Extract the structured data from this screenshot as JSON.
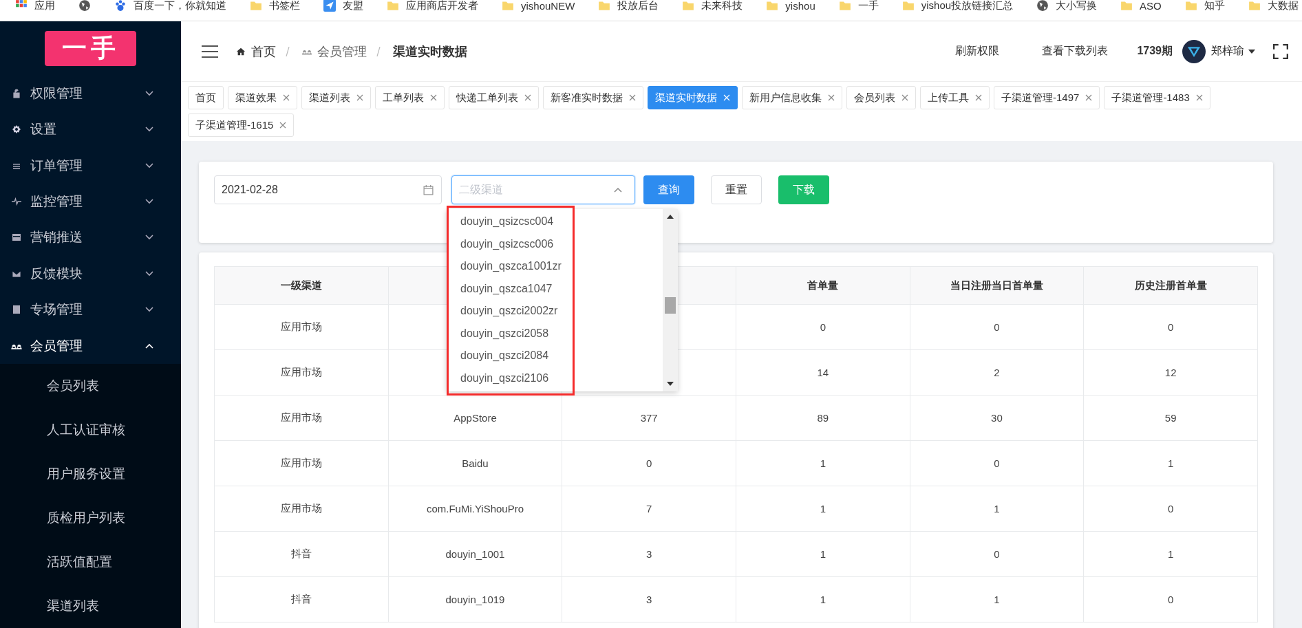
{
  "bookmarks": [
    {
      "label": "应用",
      "kind": "apps"
    },
    {
      "kind": "globe"
    },
    {
      "label": "百度一下，你就知道",
      "kind": "baidu"
    },
    {
      "label": "书签栏",
      "kind": "folder"
    },
    {
      "label": "友盟",
      "kind": "app"
    },
    {
      "label": "应用商店开发者",
      "kind": "folder"
    },
    {
      "label": "yishouNEW",
      "kind": "folder"
    },
    {
      "label": "投放后台",
      "kind": "folder"
    },
    {
      "label": "未来科技",
      "kind": "folder"
    },
    {
      "label": "yishou",
      "kind": "folder"
    },
    {
      "label": "一手",
      "kind": "folder"
    },
    {
      "label": "yishou投放链接汇总",
      "kind": "folder"
    },
    {
      "label": "大小写换",
      "kind": "globe"
    },
    {
      "label": "ASO",
      "kind": "folder"
    },
    {
      "label": "知乎",
      "kind": "folder"
    },
    {
      "label": "大数据",
      "kind": "folder"
    }
  ],
  "sidebar": {
    "logo": "一手",
    "items": [
      {
        "label": "权限管理",
        "kind": "lock",
        "expanded": false
      },
      {
        "label": "设置",
        "kind": "gear",
        "expanded": false
      },
      {
        "label": "订单管理",
        "kind": "list",
        "expanded": false
      },
      {
        "label": "监控管理",
        "kind": "pulse",
        "expanded": false
      },
      {
        "label": "营销推送",
        "kind": "card",
        "expanded": false
      },
      {
        "label": "反馈模块",
        "kind": "mail",
        "expanded": false
      },
      {
        "label": "专场管理",
        "kind": "doc",
        "expanded": false
      },
      {
        "label": "会员管理",
        "kind": "people",
        "expanded": true,
        "children": [
          {
            "label": "会员列表"
          },
          {
            "label": "人工认证审核"
          },
          {
            "label": "用户服务设置"
          },
          {
            "label": "质检用户列表"
          },
          {
            "label": "活跃值配置"
          },
          {
            "label": "渠道列表"
          }
        ]
      }
    ]
  },
  "header": {
    "breadcrumb": [
      "首页",
      "会员管理",
      "渠道实时数据"
    ],
    "actions": [
      "刷新权限",
      "查看下载列表"
    ],
    "period": "1739期",
    "user": "郑梓瑜"
  },
  "tabs": [
    {
      "label": "首页",
      "selected": false,
      "closable": false
    },
    {
      "label": "渠道效果",
      "selected": false,
      "closable": true
    },
    {
      "label": "渠道列表",
      "selected": false,
      "closable": true
    },
    {
      "label": "工单列表",
      "selected": false,
      "closable": true
    },
    {
      "label": "快递工单列表",
      "selected": false,
      "closable": true
    },
    {
      "label": "新客准实时数据",
      "selected": false,
      "closable": true
    },
    {
      "label": "渠道实时数据",
      "selected": true,
      "closable": true
    },
    {
      "label": "新用户信息收集",
      "selected": false,
      "closable": true
    },
    {
      "label": "会员列表",
      "selected": false,
      "closable": true
    },
    {
      "label": "上传工具",
      "selected": false,
      "closable": true
    },
    {
      "label": "子渠道管理-1497",
      "selected": false,
      "closable": true
    },
    {
      "label": "子渠道管理-1483",
      "selected": false,
      "closable": true
    },
    {
      "label": "子渠道管理-1615",
      "selected": false,
      "closable": true
    }
  ],
  "filter": {
    "date": "2021-02-28",
    "channel": {
      "placeholder": "二级渠道",
      "expanded": true,
      "options": [
        "douyin_qsizcsc004",
        "douyin_qsizcsc006",
        "douyin_qszca1001zr",
        "douyin_qszca1047",
        "douyin_qszci2002zr",
        "douyin_qszci2058",
        "douyin_qszci2084",
        "douyin_qszci2106"
      ]
    },
    "buttons": [
      {
        "label": "查询",
        "kind": "primary"
      },
      {
        "label": "重置",
        "kind": "plain"
      },
      {
        "label": "下载",
        "kind": "success"
      }
    ]
  },
  "table": {
    "columns": [
      "一级渠道",
      null,
      null,
      "首单量",
      "当日注册当日首单量",
      "历史注册首单量"
    ],
    "rows": [
      [
        "应用市场",
        null,
        null,
        "0",
        "0",
        "0"
      ],
      [
        "应用市场",
        null,
        null,
        "14",
        "2",
        "12"
      ],
      [
        "应用市场",
        "AppStore",
        "377",
        "89",
        "30",
        "59"
      ],
      [
        "应用市场",
        "Baidu",
        "0",
        "1",
        "0",
        "1"
      ],
      [
        "应用市场",
        "com.FuMi.YiShouPro",
        "7",
        "1",
        "1",
        "0"
      ],
      [
        "抖音",
        "douyin_1001",
        "3",
        "1",
        "0",
        "1"
      ],
      [
        "抖音",
        "douyin_1019",
        "3",
        "1",
        "1",
        "0"
      ]
    ]
  }
}
